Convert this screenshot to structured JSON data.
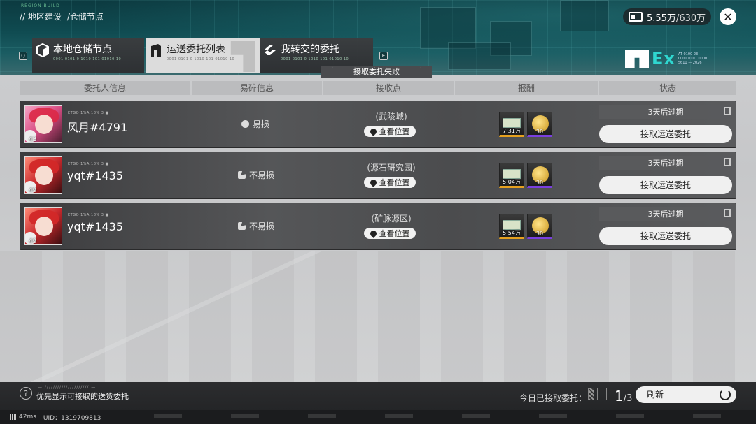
{
  "header": {
    "breadcrumb": [
      "// 地区建设",
      "/仓储节点"
    ],
    "logo_micro": "REGION BUILD",
    "currency": {
      "icon": "storage-capacity-icon",
      "current": "5.55万",
      "max": "/630万"
    },
    "close_icon": "✕",
    "brand": {
      "text": "Ex",
      "micro": "AT 0100 23\n0001 0101 0000\n5611 — 2026"
    }
  },
  "tabs": [
    {
      "key": "Q"
    },
    {
      "label": "本地仓储节点",
      "sub": "0001 0101 0 1010 101 01010 10",
      "active": false
    },
    {
      "label": "运送委托列表",
      "sub": "0001 0101 0 1010 101 01010 10",
      "active": true
    },
    {
      "label": "我转交的委托",
      "sub": "0001 0101 0 1010 101 01010 10",
      "active": false
    },
    {
      "key": "E"
    }
  ],
  "fail_banner": "接取委托失败",
  "columns": [
    "委托人信息",
    "易碎信息",
    "接收点",
    "报酬",
    "状态"
  ],
  "rows": [
    {
      "avatar": "pink",
      "level": "43",
      "meta": "ETGO 1%A 18% 3 ■",
      "name": "风月#4791",
      "fragile_icon": "gear-icon",
      "fragile": "易损",
      "location": "(武陵城)",
      "view_location": "查看位置",
      "reward1_qty": "7.31万",
      "reward2_qty": "30",
      "expire": "3天后过期",
      "accept": "接取运送委托"
    },
    {
      "avatar": "red",
      "level": "49",
      "meta": "ETGO 1%A 18% 3 ■",
      "name": "yqt#1435",
      "fragile_icon": "broken-icon",
      "fragile": "不易损",
      "location": "(源石研究园)",
      "view_location": "查看位置",
      "reward1_qty": "5.04万",
      "reward2_qty": "30",
      "expire": "3天后过期",
      "accept": "接取运送委托"
    },
    {
      "avatar": "red",
      "level": "49",
      "meta": "ETGO 1%A 18% 3 ■",
      "name": "yqt#1435",
      "fragile_icon": "broken-icon",
      "fragile": "不易损",
      "location": "(矿脉源区)",
      "view_location": "查看位置",
      "reward1_qty": "5.54万",
      "reward2_qty": "30",
      "expire": "3天后过期",
      "accept": "接取运送委托"
    }
  ],
  "footer": {
    "help": "?",
    "pref_tiny": "— ///////////////////// —",
    "pref_label": "优先显示可接取的送货委托",
    "today_label": "今日已接取委托：",
    "count_current": "1",
    "count_total": "/3",
    "refresh_label": "刷新"
  },
  "status": {
    "ping": "42ms",
    "uid": "UID：1319709813"
  }
}
